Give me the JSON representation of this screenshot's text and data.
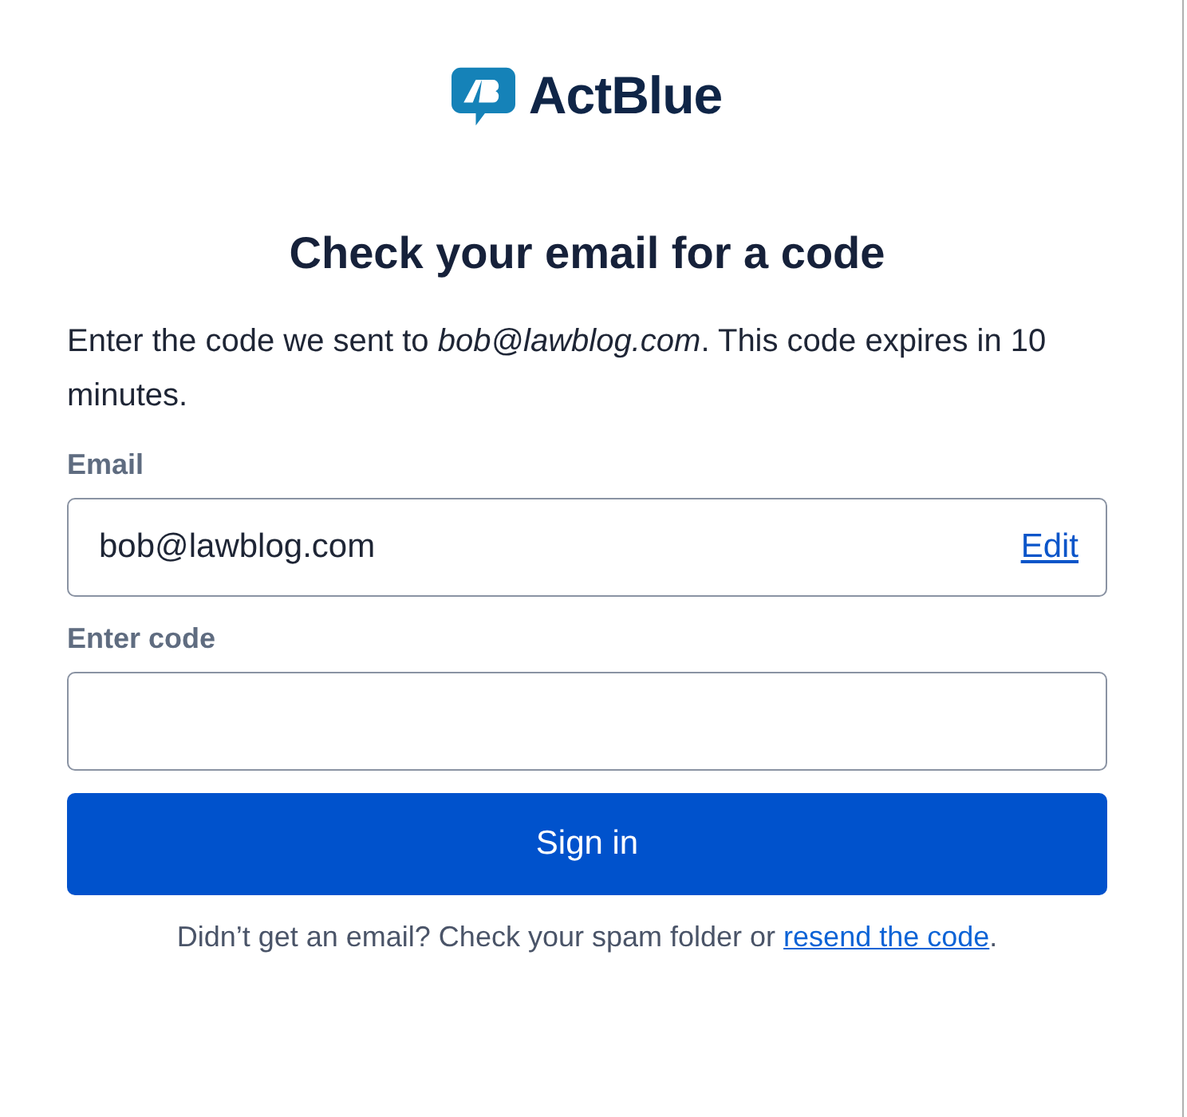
{
  "logo": {
    "text": "ActBlue"
  },
  "heading": "Check your email for a code",
  "intro": "Enter the code we sent to *bob@lawblog.com*. This code expires in 10 minutes.",
  "fields": [
    {
      "label": "Email",
      "value": "bob@lawblog.com",
      "action": "Edit"
    },
    {
      "label": "Enter code"
    }
  ],
  "submit": "Sign in",
  "footer": {
    "text": "Didn’t get an email? Check your spam folder or",
    "link": "resend the code",
    "end": "."
  }
}
